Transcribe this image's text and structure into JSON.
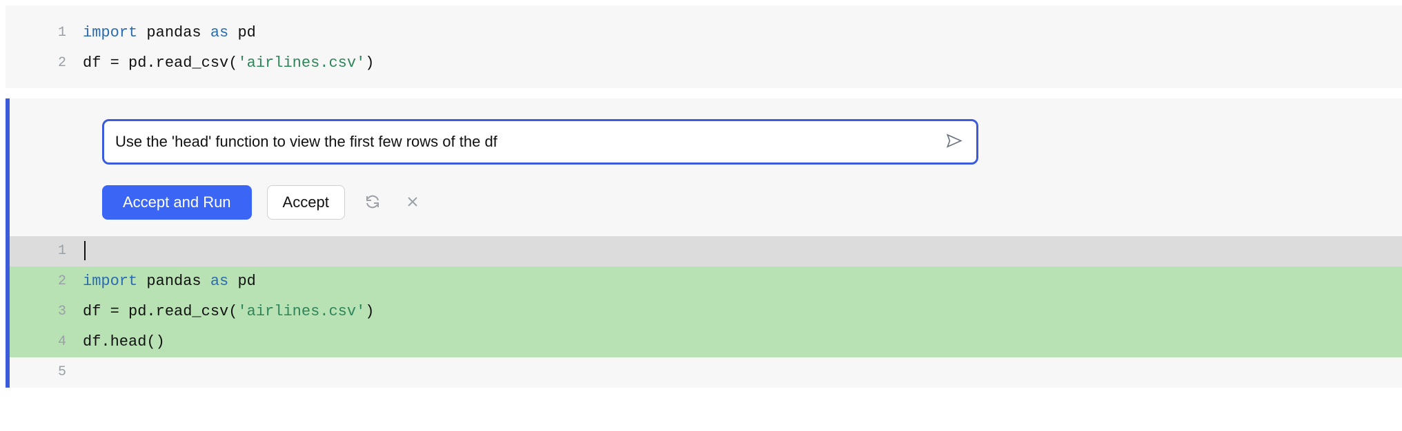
{
  "cell_top": {
    "lines": [
      {
        "num": "1",
        "tokens": [
          {
            "t": "import",
            "c": "tok-kw"
          },
          {
            "t": " pandas ",
            "c": "tok-id"
          },
          {
            "t": "as",
            "c": "tok-kw"
          },
          {
            "t": " pd",
            "c": "tok-id"
          }
        ]
      },
      {
        "num": "2",
        "tokens": [
          {
            "t": "df ",
            "c": "tok-id"
          },
          {
            "t": "=",
            "c": "tok-op"
          },
          {
            "t": " pd.read_csv(",
            "c": "tok-id"
          },
          {
            "t": "'airlines.csv'",
            "c": "tok-str"
          },
          {
            "t": ")",
            "c": "tok-id"
          }
        ]
      }
    ]
  },
  "prompt": {
    "value": "Use the 'head' function to view the first few rows of the df",
    "accept_run_label": "Accept and Run",
    "accept_label": "Accept"
  },
  "diff": {
    "rows": [
      {
        "num": "1",
        "kind": "unchanged",
        "cursor": true,
        "tokens": []
      },
      {
        "num": "2",
        "kind": "added",
        "tokens": [
          {
            "t": "import",
            "c": "tok-kw"
          },
          {
            "t": " pandas ",
            "c": "tok-id"
          },
          {
            "t": "as",
            "c": "tok-kw"
          },
          {
            "t": " pd",
            "c": "tok-id"
          }
        ]
      },
      {
        "num": "3",
        "kind": "added",
        "tokens": [
          {
            "t": "df ",
            "c": "tok-id"
          },
          {
            "t": "=",
            "c": "tok-op"
          },
          {
            "t": " pd.read_csv(",
            "c": "tok-id"
          },
          {
            "t": "'airlines.csv'",
            "c": "tok-str"
          },
          {
            "t": ")",
            "c": "tok-id"
          }
        ]
      },
      {
        "num": "4",
        "kind": "added",
        "tokens": [
          {
            "t": "df.head()",
            "c": "tok-id"
          }
        ]
      },
      {
        "num": "5",
        "kind": "blank",
        "tokens": []
      }
    ]
  }
}
